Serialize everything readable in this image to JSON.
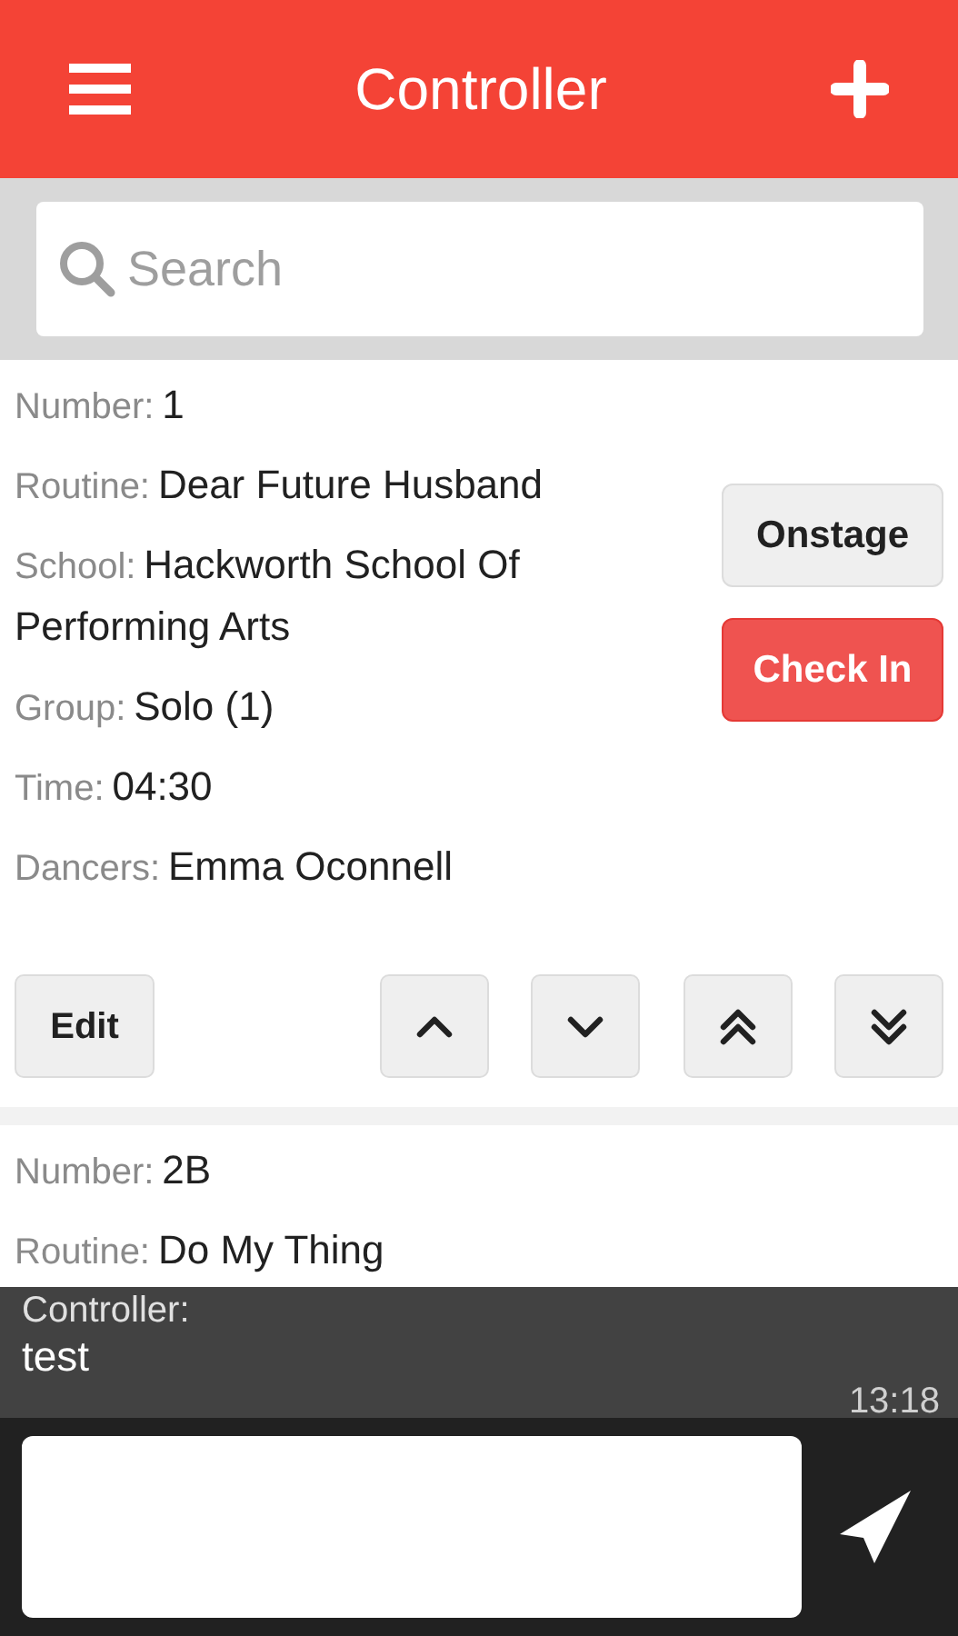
{
  "header": {
    "title": "Controller"
  },
  "search": {
    "placeholder": "Search"
  },
  "routines": [
    {
      "fields": [
        {
          "label": "Number:",
          "value": "1"
        },
        {
          "label": "Routine:",
          "value": "Dear Future Husband"
        },
        {
          "label": "School:",
          "value": "Hackworth School Of Performing Arts"
        },
        {
          "label": "Group:",
          "value": "Solo (1)"
        },
        {
          "label": "Time:",
          "value": "04:30"
        },
        {
          "label": "Dancers:",
          "value": "Emma Oconnell"
        }
      ],
      "side_buttons": [
        {
          "kind": "onstage",
          "label": "Onstage"
        },
        {
          "kind": "checkin",
          "label": "Check In"
        }
      ],
      "actions": [
        {
          "kind": "edit",
          "label": "Edit"
        },
        {
          "kind": "up"
        },
        {
          "kind": "down"
        },
        {
          "kind": "top"
        },
        {
          "kind": "bottom"
        }
      ]
    },
    {
      "fields": [
        {
          "label": "Number:",
          "value": "2B"
        },
        {
          "label": "Routine:",
          "value": "Do My Thing"
        }
      ]
    }
  ],
  "chat": {
    "sender": "Controller:",
    "message": "test",
    "time": "13:18"
  }
}
